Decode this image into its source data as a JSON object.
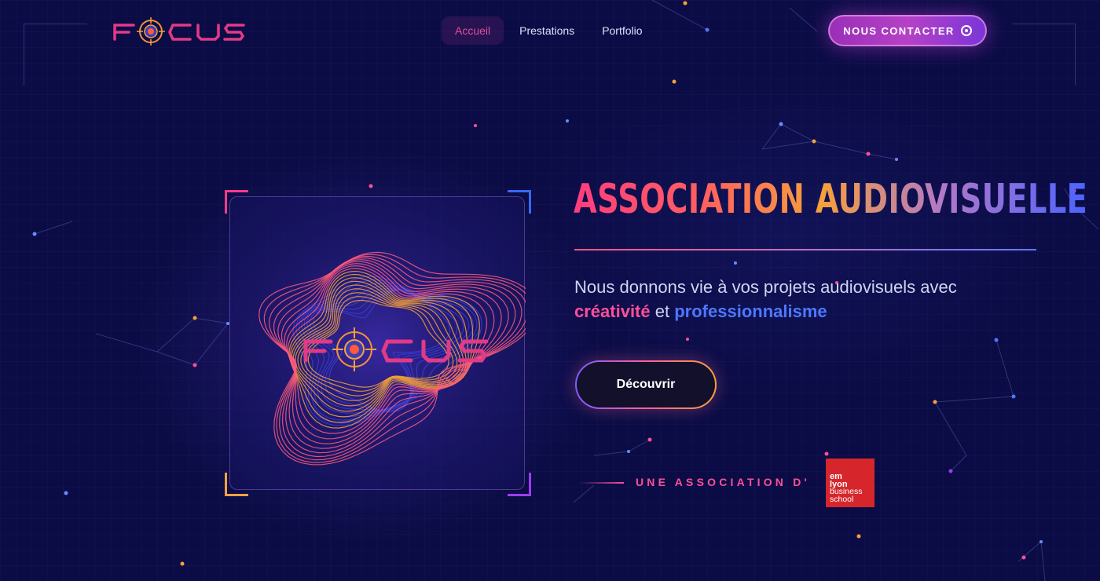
{
  "brand": {
    "name": "FOCUS"
  },
  "nav": {
    "items": [
      {
        "label": "Accueil",
        "active": true
      },
      {
        "label": "Prestations",
        "active": false
      },
      {
        "label": "Portfolio",
        "active": false
      }
    ]
  },
  "contact_button": {
    "label": "NOUS CONTACTER",
    "icon": "target-icon"
  },
  "hero": {
    "title": "ASSOCIATION AUDIOVISUELLE",
    "subtitle_prefix": "Nous donnons vie à vos projets audiovisuels avec",
    "highlight_1": "créativité",
    "connector": "et",
    "highlight_2": "professionnalisme",
    "cta_label": "Découvrir"
  },
  "affiliation": {
    "label": "UNE ASSOCIATION D'",
    "partner_logo": {
      "line1": "em",
      "line2": "lyon",
      "line3": "business",
      "line4": "school"
    }
  },
  "colors": {
    "background": "#0b0c45",
    "accent_pink": "#ff4f9a",
    "accent_orange": "#f7a03a",
    "accent_blue": "#4d78ff",
    "accent_purple": "#9c3df0",
    "partner_red": "#d6262b"
  }
}
